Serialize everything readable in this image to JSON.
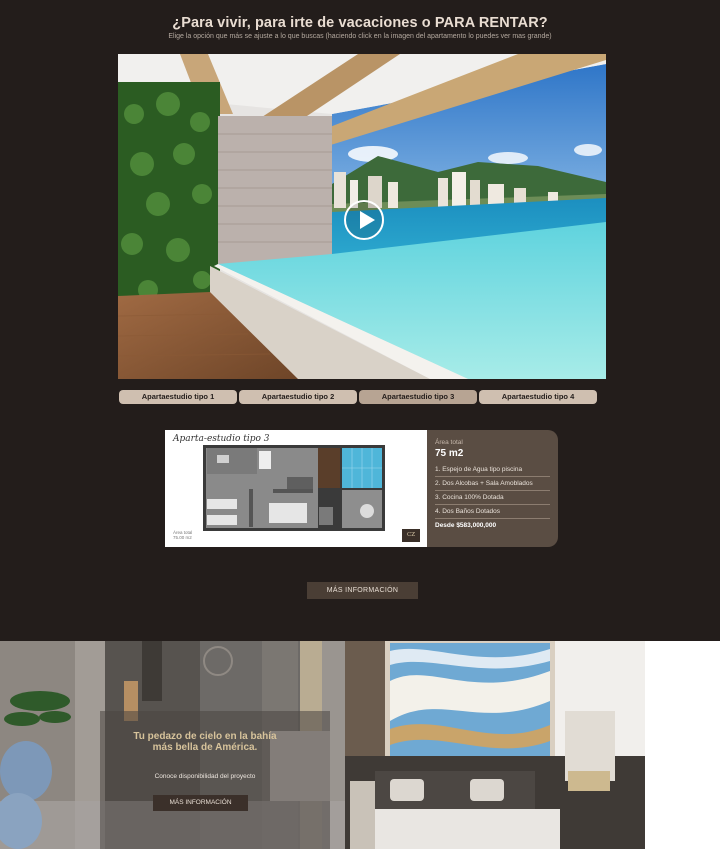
{
  "header": {
    "title": "¿Para vivir, para irte de vacaciones o PARA RENTAR?",
    "subtitle": "Elige la opción que más se ajuste a lo que buscas (haciendo click en la imagen del apartamento lo puedes ver mas grande)"
  },
  "hero": {
    "icon": "play-icon"
  },
  "tabs": [
    {
      "label": "Apartaestudio tipo 1",
      "active": false
    },
    {
      "label": "Apartaestudio tipo 2",
      "active": false
    },
    {
      "label": "Apartaestudio tipo 3",
      "active": true
    },
    {
      "label": "Apartaestudio tipo 4",
      "active": false
    }
  ],
  "plan": {
    "title": "Aparta-estudio tipo 3",
    "footnote_line1": "Área total",
    "footnote_line2": "75.00 m2",
    "logo": "CZ"
  },
  "info": {
    "area_label": "Área total",
    "area_value": "75 m2",
    "features": [
      "1. Espejo de Agua tipo piscina",
      "2. Dos Alcobas + Sala Amoblados",
      "3. Cocina 100% Dotada",
      "4. Dos Baños Dotados"
    ],
    "price": "Desde $583,000,000"
  },
  "more_button": "MÁS INFORMACIÓN",
  "promo": {
    "title": "Tu pedazo de cielo en la bahía más bella de América.",
    "subtitle": "Conoce disponibilidad del proyecto",
    "button": "MÁS INFORMACIÓN"
  },
  "colors": {
    "background": "#231d1b",
    "tab": "#cfbfb0",
    "tab_active": "#b7a493",
    "card": "#5a4d43",
    "promo_title": "#d7c39b"
  }
}
